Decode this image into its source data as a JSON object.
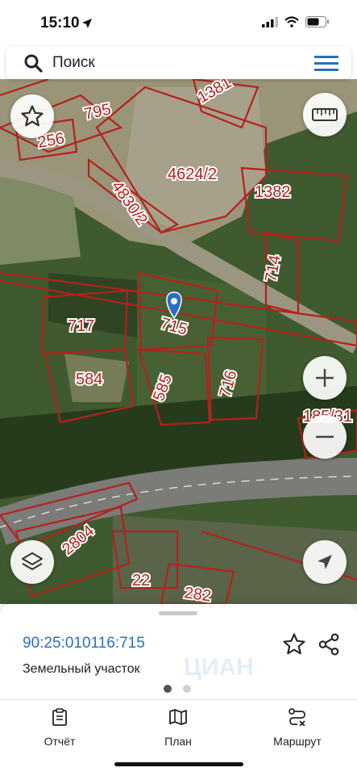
{
  "status_bar": {
    "time": "15:10"
  },
  "search": {
    "placeholder": "Поиск",
    "icon": "search-icon",
    "menu_icon": "hamburger-icon"
  },
  "map": {
    "parcels": [
      "795",
      "256",
      "1381",
      "4624/2",
      "4830/2",
      "1382",
      "714",
      "717",
      "715",
      "584",
      "585",
      "716",
      "185/31",
      "2804",
      "22",
      "282"
    ],
    "selected_parcel": "715",
    "controls": [
      "star-icon",
      "ruler-icon",
      "zoom-in-icon",
      "zoom-out-icon",
      "layers-icon",
      "location-arrow-icon"
    ]
  },
  "card": {
    "cadastral_number": "90:25:010116:715",
    "type": "Земельный участок",
    "watermark": "ЦИАН",
    "page_count": 2,
    "active_page": 0
  },
  "tabs": [
    {
      "label": "Отчёт",
      "icon": "report-icon"
    },
    {
      "label": "План",
      "icon": "map-icon"
    },
    {
      "label": "Маршрут",
      "icon": "route-icon"
    }
  ],
  "colors": {
    "accent": "#2a6fc1",
    "parcel_border": "#b5211d",
    "road": "#8e8e8e"
  }
}
